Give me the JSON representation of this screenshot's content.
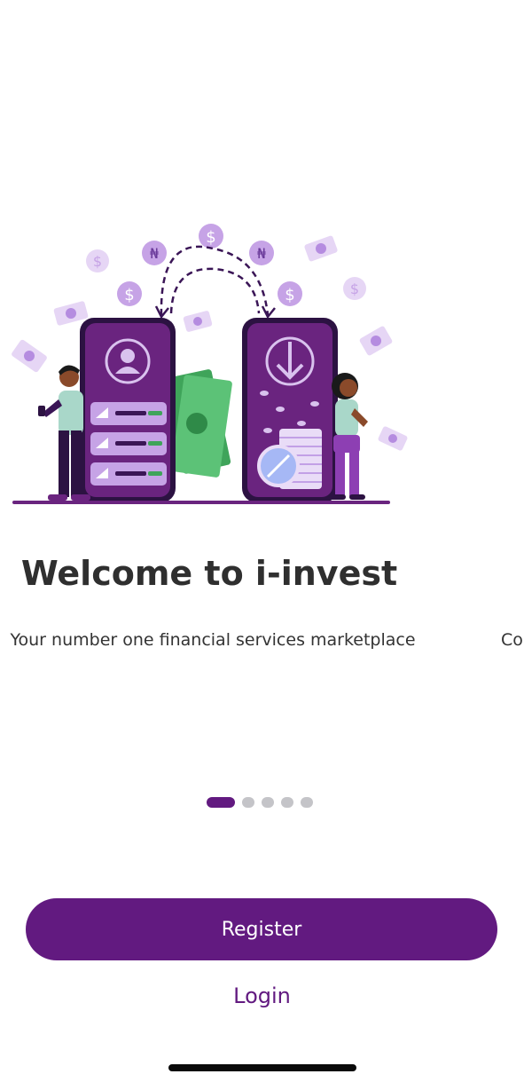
{
  "welcome": {
    "title": "Welcome to i-invest",
    "subtitle": "Your number one financial services marketplace",
    "next_slide_peek": "Co"
  },
  "carousel": {
    "total_slides": 5,
    "active_index": 0,
    "active_color": "#621a80",
    "inactive_color": "#c4c4c8"
  },
  "actions": {
    "register_label": "Register",
    "login_label": "Login"
  },
  "illustration": {
    "description_icons": [
      "person-phone-icon",
      "download-phone-icon",
      "dollar-coin-icon",
      "naira-coin-icon",
      "banknote-icon",
      "coin-stack-icon"
    ],
    "coin_dollar_symbol": "$",
    "coin_naira_symbol": "₦"
  },
  "theme": {
    "brand_purple": "#621a80",
    "light_purple": "#c6a3e6",
    "money_green": "#3fa45a"
  }
}
